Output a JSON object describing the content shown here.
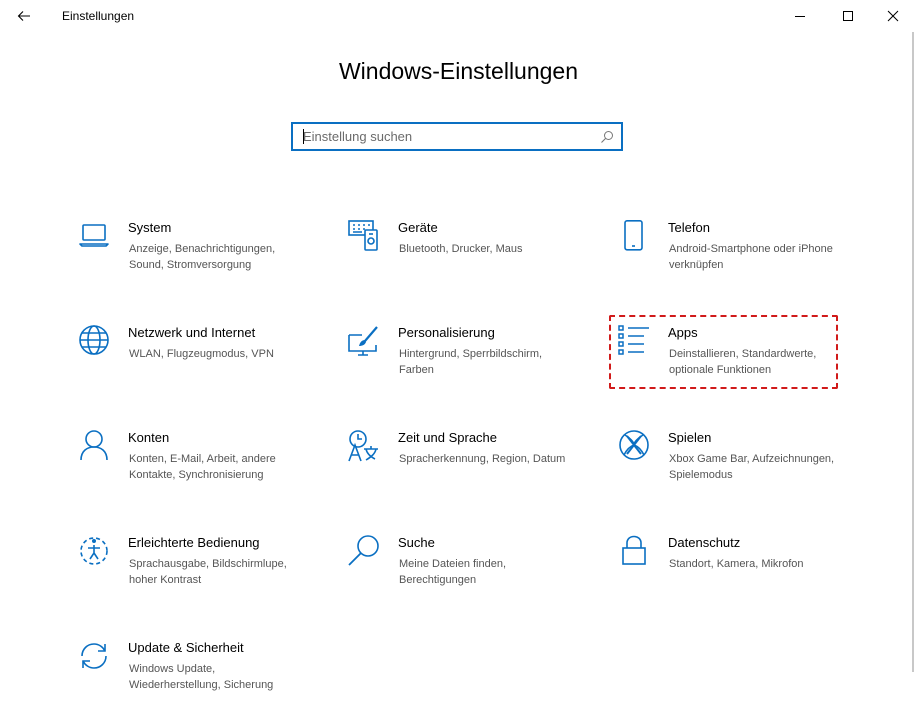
{
  "window": {
    "title": "Einstellungen",
    "icons": {
      "back": "back-arrow-icon",
      "minimize": "minimize-icon",
      "maximize": "maximize-icon",
      "close": "close-icon"
    }
  },
  "main": {
    "heading": "Windows-Einstellungen",
    "search": {
      "placeholder": "Einstellung suchen",
      "value": "",
      "icon": "search-icon"
    }
  },
  "tiles": [
    {
      "title": "System",
      "desc": "Anzeige, Benachrichtigungen, Sound, Stromversorgung",
      "icon": "laptop-icon"
    },
    {
      "title": "Geräte",
      "desc": "Bluetooth, Drucker, Maus",
      "icon": "devices-icon"
    },
    {
      "title": "Telefon",
      "desc": "Android-Smartphone oder iPhone verknüpfen",
      "icon": "phone-icon"
    },
    {
      "title": "Netzwerk und Internet",
      "desc": "WLAN, Flugzeugmodus, VPN",
      "icon": "globe-icon"
    },
    {
      "title": "Personalisierung",
      "desc": "Hintergrund, Sperrbildschirm, Farben",
      "icon": "paintbrush-icon"
    },
    {
      "title": "Apps",
      "desc": "Deinstallieren, Standardwerte, optionale Funktionen",
      "icon": "apps-list-icon",
      "highlighted": true
    },
    {
      "title": "Konten",
      "desc": "Konten, E-Mail, Arbeit, andere Kontakte, Synchronisierung",
      "icon": "person-icon"
    },
    {
      "title": "Zeit und Sprache",
      "desc": "Spracherkennung, Region, Datum",
      "icon": "time-language-icon"
    },
    {
      "title": "Spielen",
      "desc": "Xbox Game Bar, Aufzeichnungen, Spielemodus",
      "icon": "xbox-icon"
    },
    {
      "title": "Erleichterte Bedienung",
      "desc": "Sprachausgabe, Bildschirmlupe, hoher Kontrast",
      "icon": "ease-of-access-icon"
    },
    {
      "title": "Suche",
      "desc": "Meine Dateien finden, Berechtigungen",
      "icon": "magnifier-icon"
    },
    {
      "title": "Datenschutz",
      "desc": "Standort, Kamera, Mikrofon",
      "icon": "lock-icon"
    },
    {
      "title": "Update & Sicherheit",
      "desc": "Windows Update, Wiederherstellung, Sicherung",
      "icon": "sync-icon"
    }
  ],
  "colors": {
    "accent": "#0a6fc2",
    "highlight": "#d11a1a",
    "description": "#555555"
  }
}
